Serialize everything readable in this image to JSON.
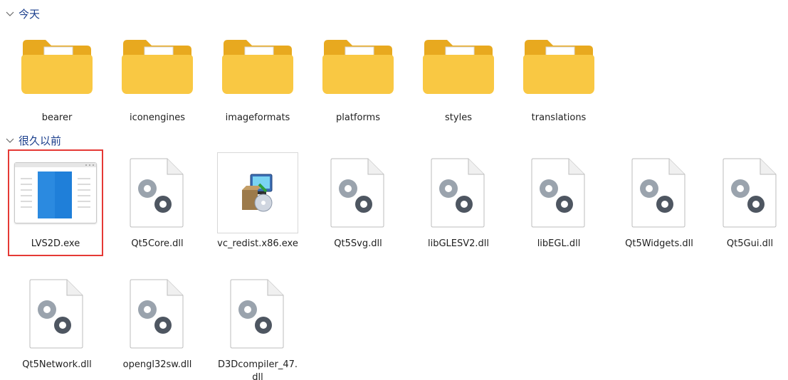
{
  "groups": {
    "today": {
      "label": "今天",
      "items": [
        {
          "name": "bearer"
        },
        {
          "name": "iconengines"
        },
        {
          "name": "imageformats"
        },
        {
          "name": "platforms"
        },
        {
          "name": "styles"
        },
        {
          "name": "translations"
        }
      ]
    },
    "long_ago": {
      "label": "很久以前",
      "items": [
        {
          "name": "LVS2D.exe"
        },
        {
          "name": "Qt5Core.dll"
        },
        {
          "name": "vc_redist.x86.exe"
        },
        {
          "name": "Qt5Svg.dll"
        },
        {
          "name": "libGLESV2.dll"
        },
        {
          "name": "libEGL.dll"
        },
        {
          "name": "Qt5Widgets.dll"
        },
        {
          "name": "Qt5Gui.dll"
        },
        {
          "name": "Qt5Network.dll"
        },
        {
          "name": "opengl32sw.dll"
        },
        {
          "name": "D3Dcompiler_47.dll"
        }
      ]
    }
  },
  "icons": {
    "folder": "folder-icon",
    "dll": "dll-gear-file-icon",
    "exe": "app-window-icon",
    "installer": "installer-package-icon"
  },
  "colors": {
    "header_text": "#1a3e8c",
    "folder_front": "#f9c843",
    "folder_back": "#e8a91f",
    "selection": "#e53935",
    "gear": "#5b6470"
  }
}
